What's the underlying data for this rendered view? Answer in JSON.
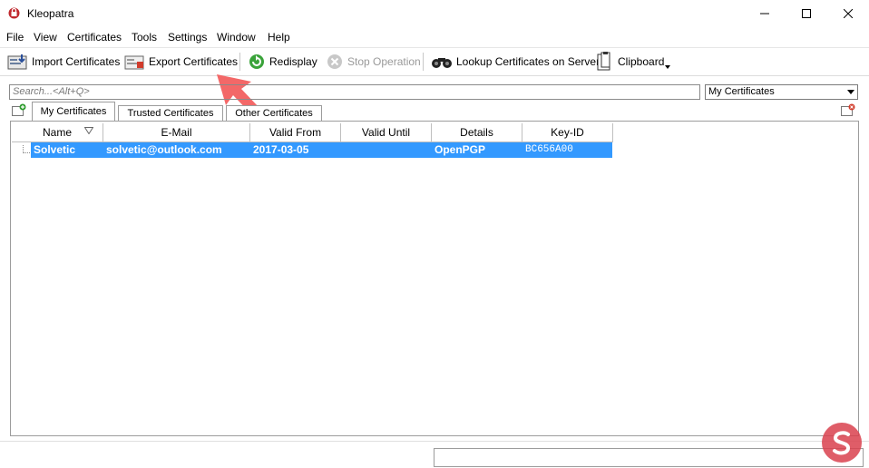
{
  "window": {
    "title": "Kleopatra",
    "app_icon": "kleopatra-icon"
  },
  "menu": [
    "File",
    "View",
    "Certificates",
    "Tools",
    "Settings",
    "Window",
    "Help"
  ],
  "toolbar": {
    "import": "Import Certificates",
    "export": "Export Certificates",
    "redisplay": "Redisplay",
    "stop": "Stop Operation",
    "lookup": "Lookup Certificates on Server",
    "clipboard": "Clipboard"
  },
  "search": {
    "placeholder": "Search...<Alt+Q>"
  },
  "filter": {
    "selected": "My Certificates"
  },
  "tabs": [
    "My Certificates",
    "Trusted Certificates",
    "Other Certificates"
  ],
  "table": {
    "columns": [
      "Name",
      "E-Mail",
      "Valid From",
      "Valid Until",
      "Details",
      "Key-ID"
    ],
    "rows": [
      {
        "name": "Solvetic",
        "email": "solvetic@outlook.com",
        "valid_from": "2017-03-05",
        "valid_until": "",
        "details": "OpenPGP",
        "key_id": "BC656A00"
      }
    ]
  },
  "colors": {
    "selection": "#3399ff",
    "annotation_arrow": "#f25b5b"
  }
}
